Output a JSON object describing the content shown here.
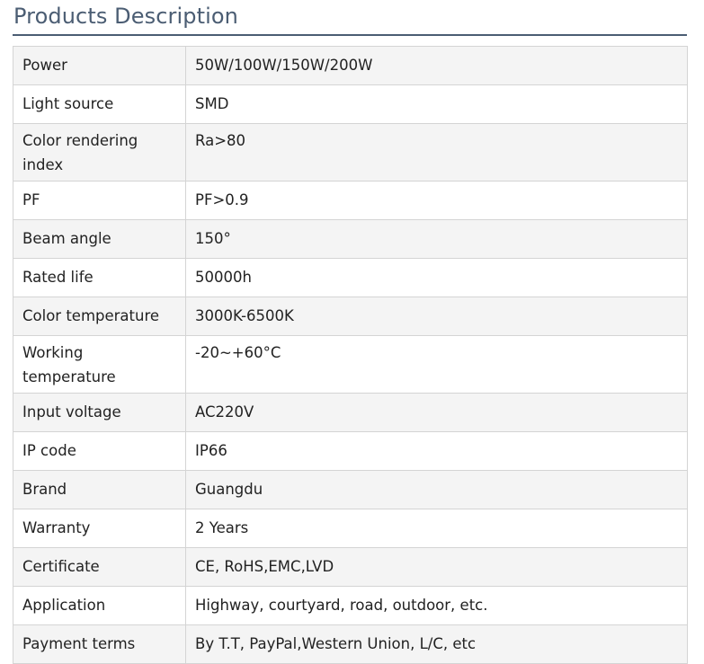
{
  "section": {
    "title": "Products Description"
  },
  "specs": [
    {
      "label": "Power",
      "value": "50W/100W/150W/200W"
    },
    {
      "label": "Light source",
      "value": "SMD"
    },
    {
      "label": "Color rendering index",
      "value": "Ra>80"
    },
    {
      "label": "PF",
      "value": "PF>0.9"
    },
    {
      "label": "Beam angle",
      "value": "150°"
    },
    {
      "label": "Rated life",
      "value": "50000h"
    },
    {
      "label": "Color temperature",
      "value": "3000K-6500K"
    },
    {
      "label": "Working temperature",
      "value": "-20~+60°C"
    },
    {
      "label": "Input voltage",
      "value": "AC220V"
    },
    {
      "label": "IP code",
      "value": "IP66"
    },
    {
      "label": "Brand",
      "value": "Guangdu"
    },
    {
      "label": "Warranty",
      "value": "2 Years"
    },
    {
      "label": "Certificate",
      "value": "CE, RoHS,EMC,LVD"
    },
    {
      "label": "Application",
      "value": "Highway, courtyard, road, outdoor, etc."
    },
    {
      "label": "Payment terms",
      "value": "By T.T, PayPal,Western Union, L/C, etc"
    }
  ],
  "colors": {
    "heading": "#4b5d73",
    "row_shade": "#f4f4f4",
    "border": "#d4d4d4"
  }
}
